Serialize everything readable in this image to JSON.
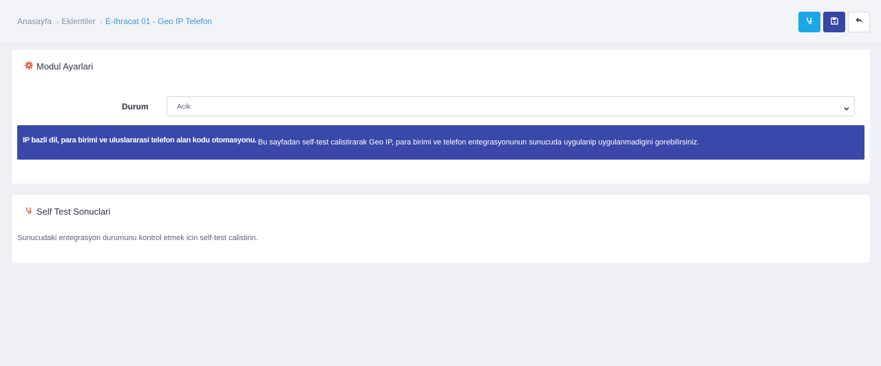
{
  "breadcrumb": {
    "home": "Anasayfa",
    "plugins": "Eklentiler",
    "current": "E-Ihracat 01 - Geo IP Telefon",
    "separator": "›"
  },
  "toolbar": {
    "buttons": [
      {
        "name": "self-test-button",
        "icon": "stethoscope-icon",
        "color": "#19a7e8"
      },
      {
        "name": "save-button",
        "icon": "floppy-disk-icon",
        "color": "#3646a6"
      },
      {
        "name": "back-button",
        "icon": "reply-arrow-icon",
        "color": "#ffffff"
      }
    ]
  },
  "module_settings": {
    "title": "Modul Ayarlari",
    "icon": "gear-icon",
    "status_label": "Durum",
    "status_value": "Acik",
    "info_strong": "IP bazli dil, para birimi ve uluslararasi telefon alan kodu otomasyonu.",
    "info_text": "Bu sayfadan self-test calistirarak Geo IP, para birimi ve telefon entegrasyonunun sunucuda uygulanip uygulanmadigini gorebilirsiniz."
  },
  "self_test": {
    "title": "Self Test Sonuclari",
    "icon": "stethoscope-icon",
    "message": "Sunucudaki entegrasyon durumunu kontrol etmek icin self-test calistirin."
  },
  "colors": {
    "accent_orange": "#e8573a",
    "banner": "#3a48a9",
    "link": "#3f97c9"
  }
}
